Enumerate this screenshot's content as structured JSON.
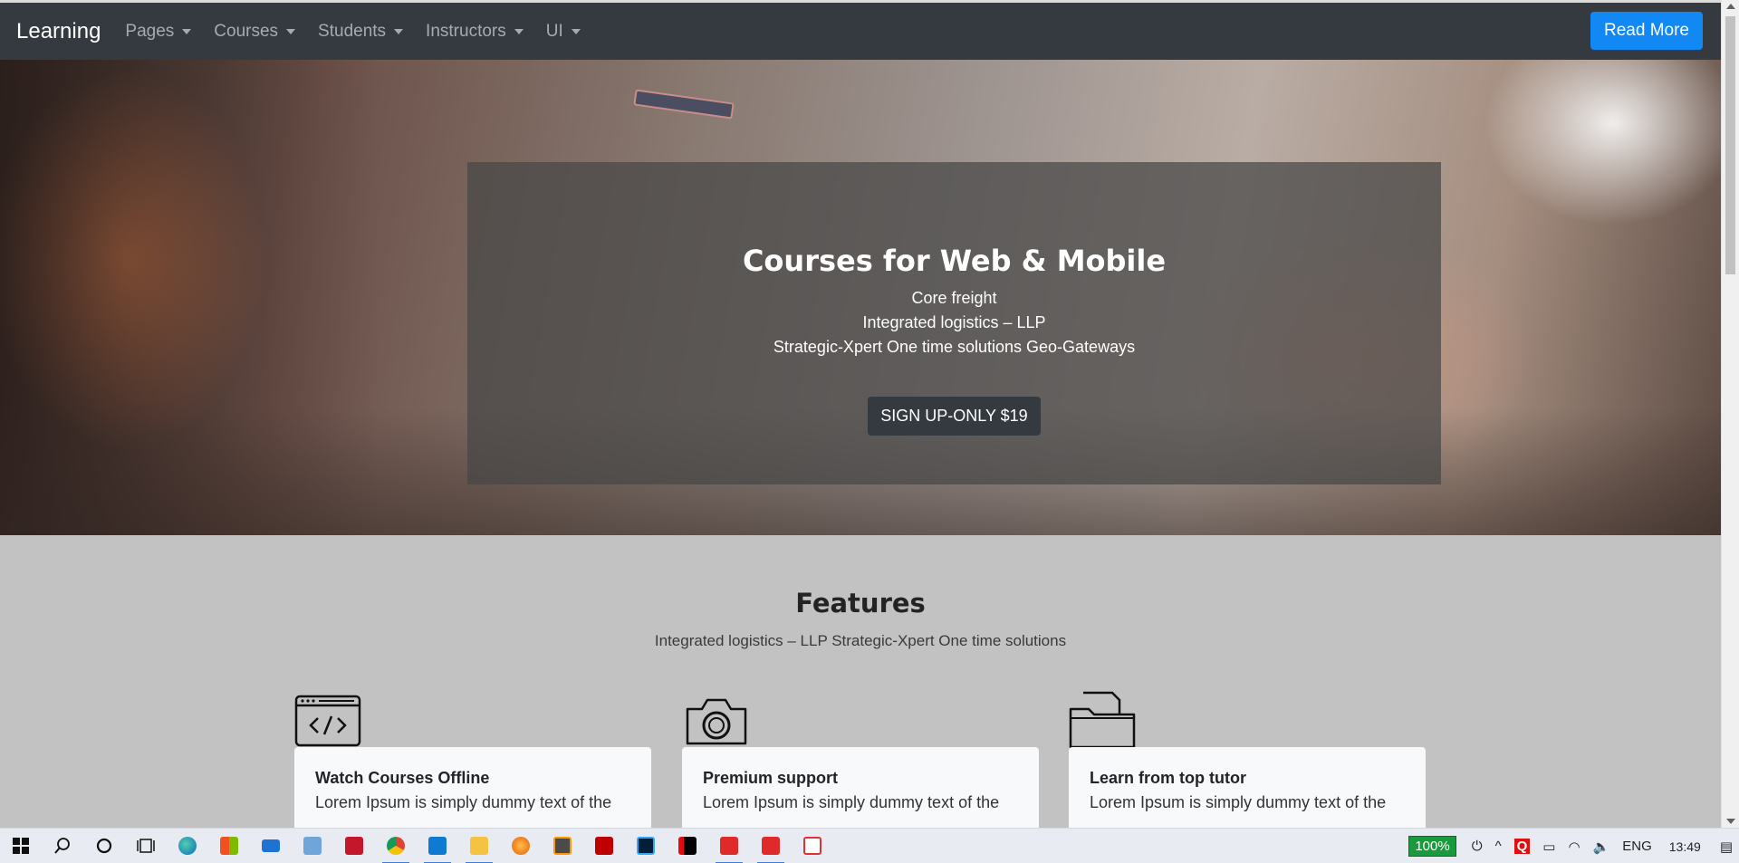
{
  "navbar": {
    "brand": "Learning",
    "items": [
      {
        "label": "Pages"
      },
      {
        "label": "Courses"
      },
      {
        "label": "Students"
      },
      {
        "label": "Instructors"
      },
      {
        "label": "UI"
      }
    ],
    "cta_label": "Read More"
  },
  "hero": {
    "title": "Courses for Web & Mobile",
    "lines": [
      "Core freight",
      "Integrated logistics – LLP",
      "Strategic-Xpert One time solutions Geo-Gateways"
    ],
    "button_label": "SIGN UP-ONLY $19"
  },
  "features": {
    "title": "Features",
    "subtitle": "Integrated logistics – LLP Strategic-Xpert One time solutions",
    "items": [
      {
        "icon": "code-window-icon",
        "title": "Watch Courses Offline",
        "text": "Lorem Ipsum is simply dummy text of the"
      },
      {
        "icon": "camera-icon",
        "title": "Premium support",
        "text": "Lorem Ipsum is simply dummy text of the"
      },
      {
        "icon": "folder-icon",
        "title": "Learn from top tutor",
        "text": "Lorem Ipsum is simply dummy text of the"
      }
    ]
  },
  "taskbar": {
    "apps": [
      "windows-start-icon",
      "search-icon",
      "cortana-icon",
      "task-view-icon",
      "edge-icon",
      "store-icon",
      "mail-icon",
      "app-icon",
      "app-red-icon",
      "chrome-icon",
      "vscode-icon",
      "file-explorer-icon",
      "firefox-icon",
      "sublime-icon",
      "filezilla-icon",
      "photoshop-icon",
      "netflix-icon",
      "app-red2-icon",
      "app-red3-icon",
      "snip-icon"
    ],
    "battery": "100%",
    "language": "ENG",
    "time": "13:49"
  },
  "colors": {
    "navbar_bg": "#343a40",
    "cta_bg": "#1288f5",
    "section_bg": "#c2c2c2",
    "card_bg": "#f8f9fa"
  }
}
